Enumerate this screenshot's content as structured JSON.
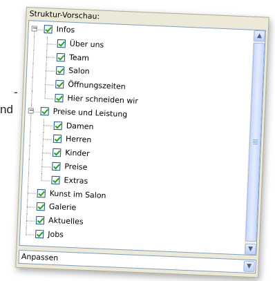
{
  "background_text": {
    "fragment1": "-",
    "fragment2": "nd"
  },
  "panel": {
    "title": "Struktur-Vorschau:"
  },
  "tree": {
    "items": [
      {
        "label": "Infos",
        "level": 0,
        "expanded": true,
        "checked": true
      },
      {
        "label": "Über uns",
        "level": 1,
        "checked": true
      },
      {
        "label": "Team",
        "level": 1,
        "checked": true
      },
      {
        "label": "Salon",
        "level": 1,
        "checked": true
      },
      {
        "label": "Öffnungszeiten",
        "level": 1,
        "checked": true
      },
      {
        "label": "Hier schneiden wir",
        "level": 1,
        "checked": true
      },
      {
        "label": "Preise und Leistung",
        "level": 0,
        "expanded": true,
        "checked": true
      },
      {
        "label": "Damen",
        "level": 1,
        "checked": true
      },
      {
        "label": "Herren",
        "level": 1,
        "checked": true
      },
      {
        "label": "Kinder",
        "level": 1,
        "checked": true
      },
      {
        "label": "Preise",
        "level": 1,
        "checked": true
      },
      {
        "label": "Extras",
        "level": 1,
        "checked": true
      },
      {
        "label": "Kunst im Salon",
        "level": 0,
        "checked": true
      },
      {
        "label": "Galerie",
        "level": 0,
        "checked": true
      },
      {
        "label": "Aktuelles",
        "level": 0,
        "checked": true
      },
      {
        "label": "Jobs",
        "level": 0,
        "checked": true
      }
    ]
  },
  "combo": {
    "value": "Anpassen"
  },
  "icons": {
    "scroll_up": "▲",
    "scroll_down": "▼",
    "dropdown": "▼",
    "collapse": "−"
  },
  "colors": {
    "panel_bg": "#ece9d8",
    "check_green": "#21a121",
    "border_blue": "#7f9db9"
  }
}
